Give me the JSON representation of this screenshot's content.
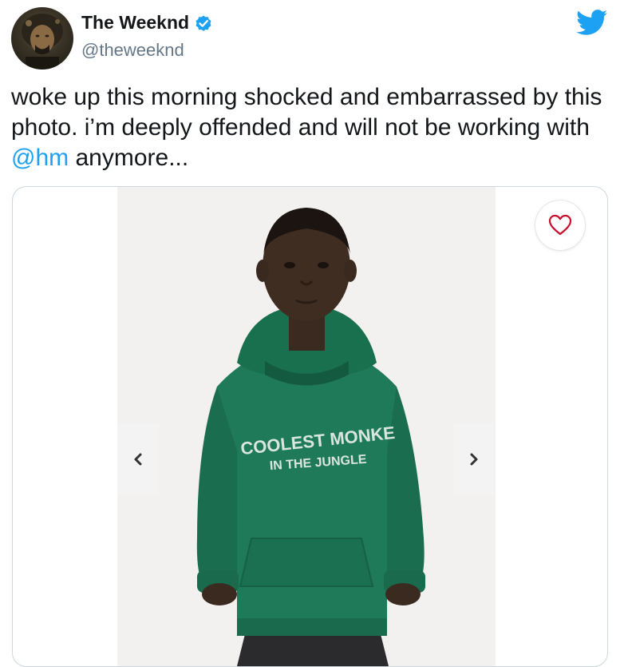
{
  "tweet": {
    "author_name": "The Weeknd",
    "verified_icon": "verified-badge-icon",
    "handle": "@theweeknd",
    "logo_icon": "twitter-bird-icon",
    "text_before": "woke up this morning shocked and embarrassed by this photo. i’m deeply offended and will not be working with ",
    "mention": "@hm",
    "text_after": " anymore..."
  },
  "media": {
    "hoodie_line1": "COOLEST MONKE",
    "hoodie_line2": "IN THE JUNGLE",
    "favorite_icon": "heart-outline-icon",
    "prev_icon": "chevron-left-icon",
    "next_icon": "chevron-right-icon"
  },
  "colors": {
    "link": "#1da1f2",
    "verified": "#1da1f2",
    "handle": "#657786",
    "heart": "#c8102e",
    "hoodie": "#1f7a5a"
  }
}
